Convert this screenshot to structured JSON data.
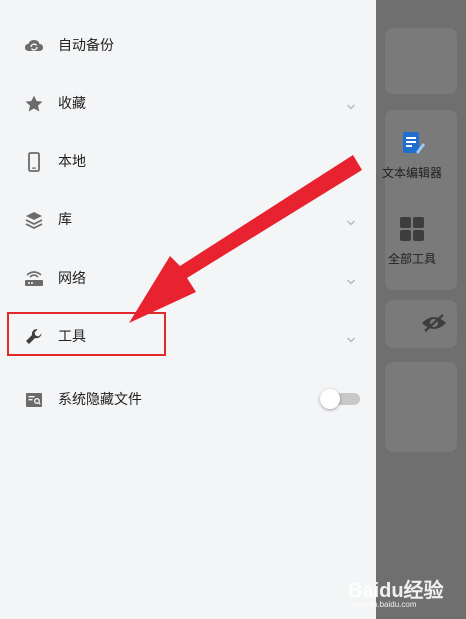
{
  "drawer": {
    "items": [
      {
        "label": "自动备份",
        "icon": "cloud-sync-icon",
        "has_chevron": false
      },
      {
        "label": "收藏",
        "icon": "star-icon",
        "has_chevron": true
      },
      {
        "label": "本地",
        "icon": "phone-icon",
        "has_chevron": true
      },
      {
        "label": "库",
        "icon": "layers-icon",
        "has_chevron": true
      },
      {
        "label": "网络",
        "icon": "router-icon",
        "has_chevron": true
      },
      {
        "label": "工具",
        "icon": "wrench-icon",
        "has_chevron": true
      },
      {
        "label": "系统隐藏文件",
        "icon": "search-file-icon",
        "has_chevron": false
      }
    ],
    "hidden_files_toggle": false
  },
  "background": {
    "tools": [
      {
        "label": "文本编辑器",
        "icon": "text-editor-icon"
      },
      {
        "label": "全部工具",
        "icon": "grid-icon"
      }
    ],
    "eye_icon": "eye-off-icon"
  },
  "annotation": {
    "highlight_color": "#e02a2a",
    "arrow_color": "#e8232f"
  },
  "watermark": {
    "text": "Baidu经验",
    "sub": "jingyan.baidu.com"
  }
}
